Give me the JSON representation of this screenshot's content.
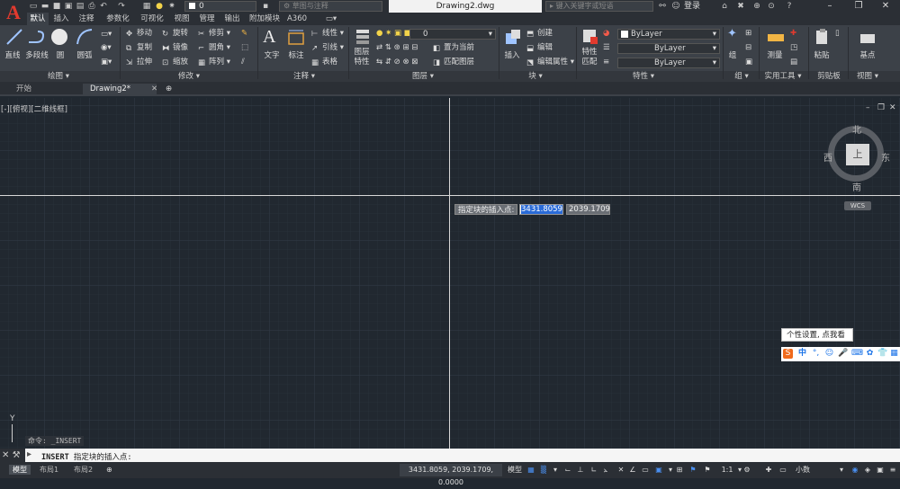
{
  "app": {
    "logo_letter": "A",
    "document_title": "Drawing2.dwg",
    "workspace_placeholder": "草图与注释",
    "search_placeholder": "键入关键字或短语",
    "login_label": "登录",
    "qa_layer_value": "0"
  },
  "ribbon_tabs": [
    "默认",
    "插入",
    "注释",
    "参数化",
    "可视化",
    "视图",
    "管理",
    "输出",
    "附加模块",
    "A360"
  ],
  "panels": {
    "draw": {
      "title": "绘图 ▾",
      "line": "直线",
      "polyline": "多段线",
      "circle": "圆",
      "arc": "圆弧"
    },
    "modify": {
      "title": "修改 ▾",
      "move": "移动",
      "rotate": "旋转",
      "trim": "修剪 ▾",
      "copy": "复制",
      "mirror": "镜像",
      "fillet": "圆角 ▾",
      "stretch": "拉伸",
      "scale": "缩放",
      "array": "阵列 ▾"
    },
    "annotation": {
      "title": "注释 ▾",
      "text": "文字",
      "dimension": "标注",
      "linear": "线性 ▾",
      "leader": "引线 ▾",
      "table": "表格"
    },
    "layers": {
      "title": "图层 ▾",
      "layer_props_1": "图层",
      "layer_props_2": "特性",
      "layer_value": "0",
      "set_current": "置为当前",
      "match_layer": "匹配图层"
    },
    "block": {
      "title": "块 ▾",
      "insert": "插入",
      "create": "创建",
      "edit": "编辑",
      "edit_attr": "编辑属性 ▾"
    },
    "properties": {
      "title": "特性 ▾",
      "match_1": "特性",
      "match_2": "匹配",
      "color": "ByLayer",
      "linetype": "ByLayer",
      "lineweight": "ByLayer"
    },
    "groups": {
      "title": "组 ▾",
      "group": "组"
    },
    "utilities": {
      "title": "实用工具 ▾",
      "measure": "测量"
    },
    "clipboard": {
      "title": "剪贴板",
      "paste": "粘贴"
    },
    "view": {
      "title": "视图 ▾",
      "base": "基点"
    }
  },
  "file_tabs": [
    "开始",
    "Drawing2*"
  ],
  "viewport": {
    "label": "[-][俯视][二维线框]",
    "prompt": "指定块的插入点:",
    "x_value": "3431.8059",
    "y_value": "2039.1709",
    "cube_face": "上",
    "north": "北",
    "south": "南",
    "east": "东",
    "west": "西",
    "wcs": "WCS",
    "ucs_y": "Y"
  },
  "ime": {
    "tooltip": "个性设置, 点我看看",
    "lang": "中"
  },
  "command": {
    "history": "命令: _INSERT",
    "keyword": "INSERT",
    "current": "指定块的插入点:"
  },
  "layout_tabs": [
    "模型",
    "布局1",
    "布局2"
  ],
  "status": {
    "coords": "3431.8059, 2039.1709, 0.0000",
    "model": "模型",
    "scale": "1:1",
    "units": "小数"
  },
  "colors": {
    "canvas": "#212830",
    "ribbon": "#3c4148",
    "accent": "#2a6bd8",
    "logo_red": "#e23a2e"
  }
}
